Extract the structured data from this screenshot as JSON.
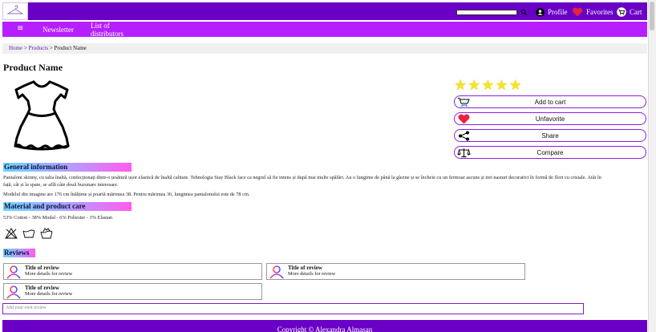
{
  "header": {
    "search": {
      "value": "",
      "placeholder": ""
    },
    "profile_label": "Profile",
    "favorites_label": "Favorites",
    "cart_label": "Cart"
  },
  "menu": {
    "hamburger": "≡",
    "items": [
      {
        "label": "Newsletter"
      },
      {
        "line1": "List of",
        "line2": "distributors"
      }
    ]
  },
  "breadcrumb": {
    "home": "Home",
    "sep1": ">",
    "products": "Products",
    "sep2": ">",
    "current": "Product Name"
  },
  "product": {
    "name": "Product Name",
    "rating": {
      "value": 5,
      "max": 5
    },
    "actions": {
      "add_to_cart": "Add to cart",
      "unfavorite": "Unfavorite",
      "share": "Share",
      "compare": "Compare"
    }
  },
  "general": {
    "heading": "General information",
    "p1": "Pantaloni skinny, cu talia înaltă, confecționați dintr-o țesătură ușor elastică de înaltă calitate. Tehnologia Stay Black face ca negrul să fie intens și după mai multe spălări. Au o lungime de până la glezne și se încheie cu un fermoar ascuns și trei nasturi decorativi în formă de flori cu cristale. Atât în",
    "p1b": "față, cât și la spate, se află câte două buzunare interesare.",
    "p2": "Modelul din imagine are 176 cm înălțime și poartă mărimea 38. Pentru mărimea 36, lungimea pantalonului este de 78 cm."
  },
  "care": {
    "heading": "Material and product care",
    "composition": "53% Cotton - 38% Modal - 6% Poliester - 3% Elastan",
    "icons": [
      "no-bleach-icon",
      "wash-30-icon",
      "hand-wash-icon"
    ]
  },
  "reviews": {
    "heading": "Reviews",
    "items": [
      {
        "title": "Title of review",
        "details": "More details for review"
      },
      {
        "title": "Title of review",
        "details": "More details for review"
      },
      {
        "title": "Title of review",
        "details": "More details for review"
      }
    ],
    "add_placeholder": "Add your own review"
  },
  "footer": {
    "text": "Copyright © Alexandra Almasan"
  },
  "colors": {
    "header_bg": "#6a00c6",
    "menu_bg": "#b61fff",
    "accent_border": "#8a1fe0",
    "star": "#f4e425",
    "heart": "#e8233e"
  }
}
